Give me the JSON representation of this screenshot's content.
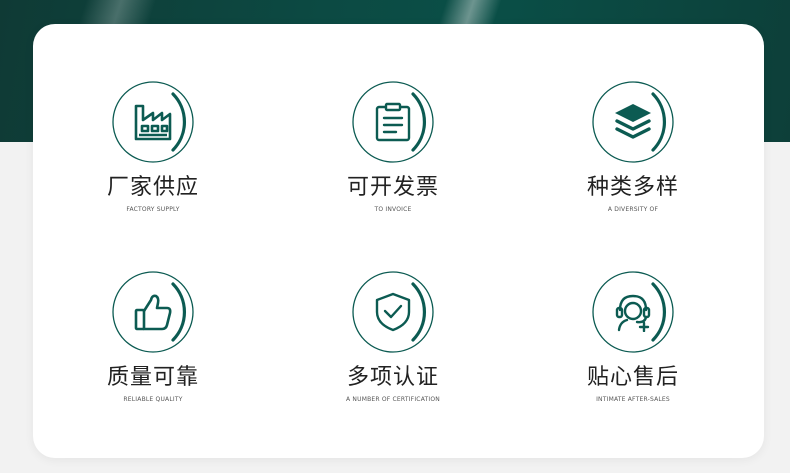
{
  "colors": {
    "accent": "#0c5b52",
    "hero": "#0c4a43",
    "card": "#ffffff",
    "title": "#222222"
  },
  "features": [
    {
      "icon": "factory-icon",
      "title": "厂家供应",
      "subtitle": "FACTORY SUPPLY"
    },
    {
      "icon": "clipboard-icon",
      "title": "可开发票",
      "subtitle": "TO INVOICE"
    },
    {
      "icon": "layers-icon",
      "title": "种类多样",
      "subtitle": "A DIVERSITY OF"
    },
    {
      "icon": "thumbs-up-icon",
      "title": "质量可靠",
      "subtitle": "RELIABLE QUALITY"
    },
    {
      "icon": "shield-check-icon",
      "title": "多项认证",
      "subtitle": "A NUMBER OF CERTIFICATION"
    },
    {
      "icon": "customer-service-icon",
      "title": "贴心售后",
      "subtitle": "INTIMATE AFTER-SALES"
    }
  ]
}
